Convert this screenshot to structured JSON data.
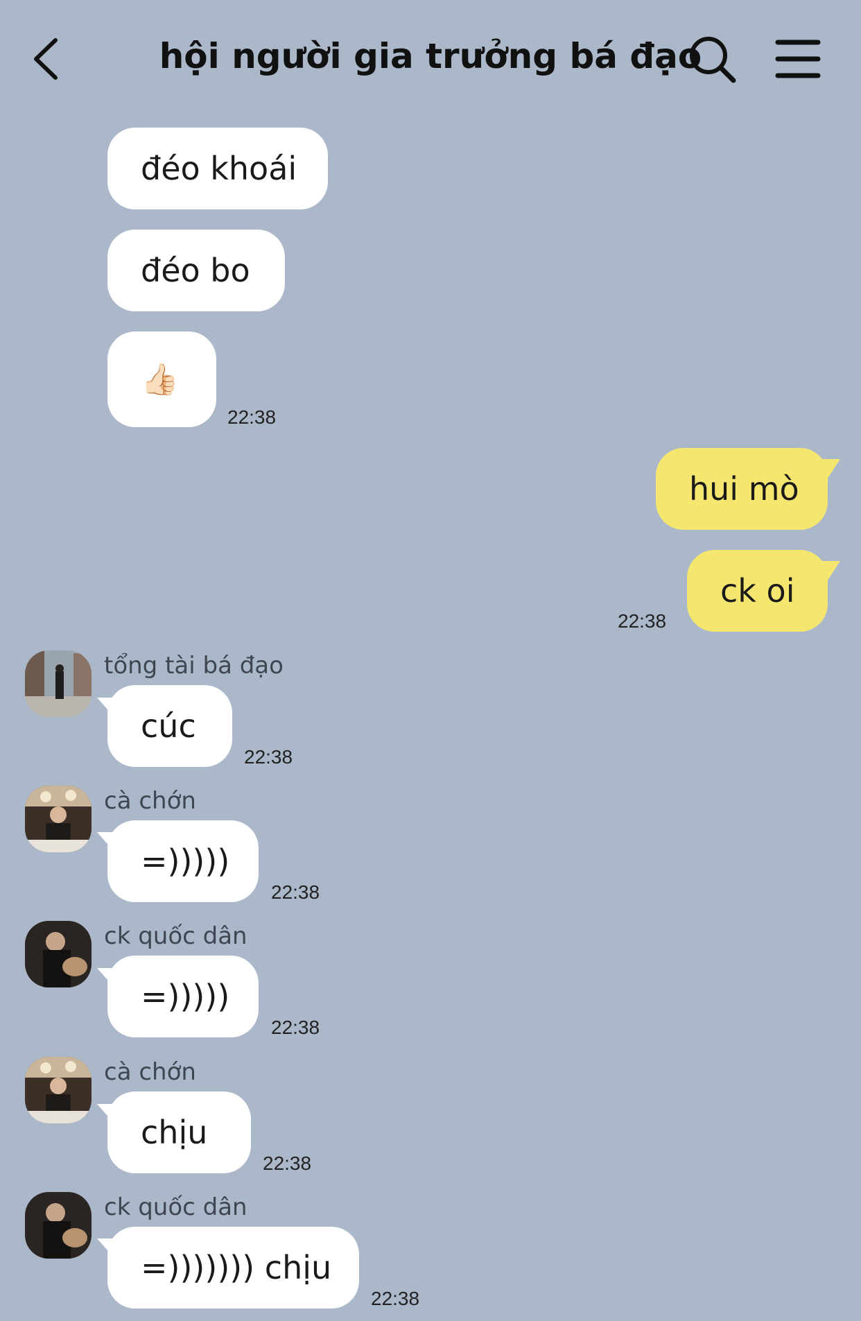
{
  "header": {
    "title": "hội người gia trưởng bá đạo",
    "back_icon": "chevron-left-icon",
    "search_icon": "search-icon",
    "menu_icon": "hamburger-menu-icon"
  },
  "messages": [
    {
      "sender": "",
      "text": "đéo khoái",
      "time": "",
      "direction": "in"
    },
    {
      "sender": "",
      "text": "đéo bo",
      "time": "",
      "direction": "in"
    },
    {
      "sender": "",
      "text": "👍🏻",
      "time": "22:38",
      "direction": "in"
    },
    {
      "sender": "",
      "text": "hui mò",
      "time": "",
      "direction": "out"
    },
    {
      "sender": "",
      "text": "ck oi",
      "time": "22:38",
      "direction": "out"
    },
    {
      "sender": "tổng tài bá đạo",
      "text": "cúc",
      "time": "22:38",
      "direction": "in"
    },
    {
      "sender": "cà chớn",
      "text": "=)))))",
      "time": "22:38",
      "direction": "in"
    },
    {
      "sender": "ck quốc dân",
      "text": "=)))))",
      "time": "22:38",
      "direction": "in"
    },
    {
      "sender": "cà chớn",
      "text": "chịu",
      "time": "22:38",
      "direction": "in"
    },
    {
      "sender": "ck quốc dân",
      "text": "=))))))) chịu",
      "time": "22:38",
      "direction": "in"
    }
  ],
  "colors": {
    "background": "#abb8ca",
    "incoming_bubble": "#ffffff",
    "outgoing_bubble": "#f5e66f"
  }
}
